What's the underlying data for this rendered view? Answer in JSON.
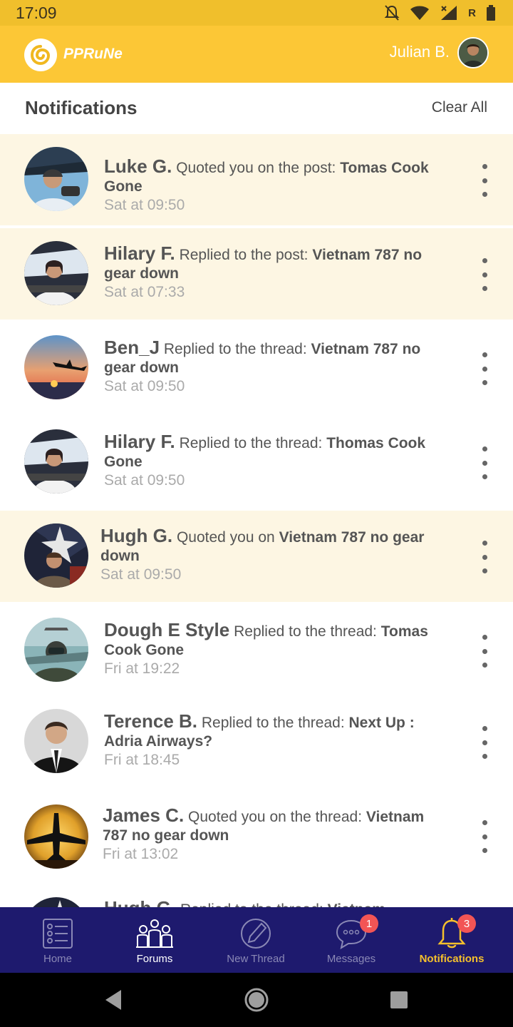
{
  "status_bar": {
    "time": "17:09",
    "carrier_letter": "R"
  },
  "app_bar": {
    "logo_text": "PPRuNe",
    "user_name": "Julian B."
  },
  "header": {
    "title": "Notifications",
    "clear_all": "Clear All"
  },
  "notifications": [
    {
      "name": "Luke G.",
      "action": "Quoted you on the post:",
      "thread": "Tomas Cook Gone",
      "time": "Sat at 09:50",
      "unread": true,
      "avatar": "pilot-cockpit"
    },
    {
      "name": "Hilary F.",
      "action": "Replied to the post:",
      "thread": "Vietnam 787 no gear down",
      "time": "Sat at 07:33",
      "unread": true,
      "avatar": "female-pilot"
    },
    {
      "name": "Ben_J",
      "action": "Replied to the thread:",
      "thread": "Vietnam 787 no gear down",
      "time": "Sat at 09:50",
      "unread": false,
      "avatar": "sunset-plane"
    },
    {
      "name": "Hilary F.",
      "action": "Replied to the thread:",
      "thread": "Thomas Cook Gone",
      "time": "Sat at 09:50",
      "unread": false,
      "avatar": "female-pilot"
    },
    {
      "name": "Hugh G.",
      "action": "Quoted you on",
      "thread": "Vietnam 787 no gear down",
      "time": "Sat at 09:50",
      "unread": true,
      "avatar": "man-star"
    },
    {
      "name": "Dough E Style",
      "action": "Replied to the thread:",
      "thread": "Tomas Cook Gone",
      "time": "Fri at 19:22",
      "unread": false,
      "avatar": "jet-pilot"
    },
    {
      "name": "Terence B.",
      "action": "Replied to the thread:",
      "thread": "Next Up : Adria Airways?",
      "time": "Fri at 18:45",
      "unread": false,
      "avatar": "man-suit"
    },
    {
      "name": "James C.",
      "action": "Quoted you on the thread:",
      "thread": "Vietnam 787 no gear down",
      "time": "Fri at 13:02",
      "unread": false,
      "avatar": "plane-silhouette"
    },
    {
      "name": "Hugh G.",
      "action": "Replied to the thread:",
      "thread": "Vietnam",
      "time": "",
      "unread": false,
      "avatar": "man-star"
    }
  ],
  "bottom_nav": [
    {
      "label": "Home",
      "icon": "list-icon"
    },
    {
      "label": "Forums",
      "icon": "people-icon"
    },
    {
      "label": "New Thread",
      "icon": "pen-icon"
    },
    {
      "label": "Messages",
      "icon": "chat-icon",
      "badge": "1"
    },
    {
      "label": "Notifications",
      "icon": "bell-icon",
      "badge": "3"
    }
  ],
  "colors": {
    "accent": "#fcc736",
    "nav_bg": "#1e1a6e",
    "unread_bg": "#fdf6e3",
    "badge": "#f25555"
  }
}
